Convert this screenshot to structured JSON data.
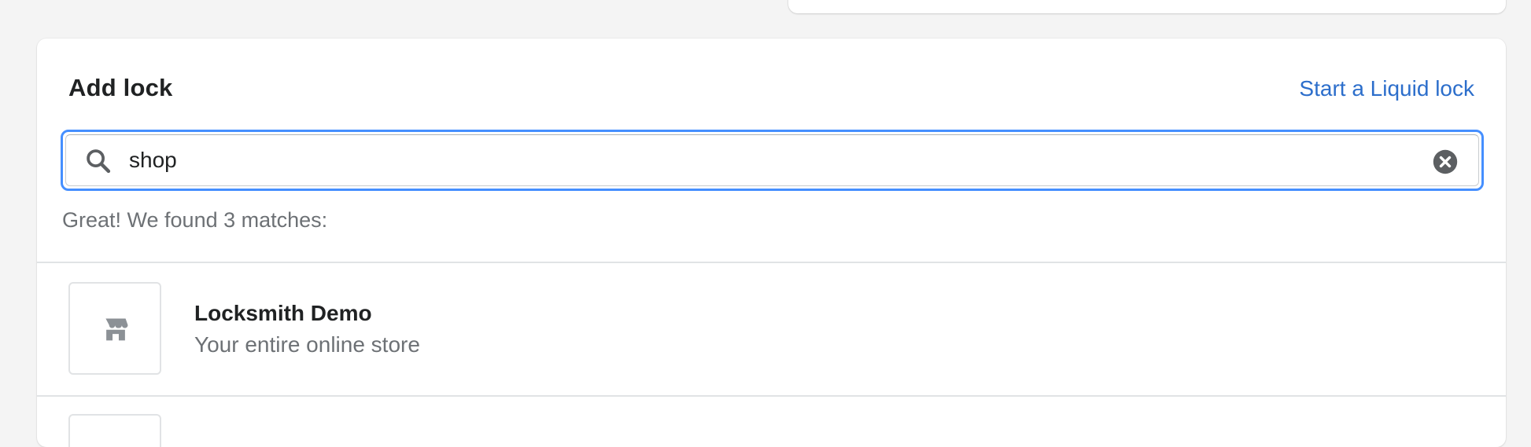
{
  "add_lock": {
    "title": "Add lock",
    "liquid_link": "Start a Liquid lock"
  },
  "search": {
    "value": "shop",
    "icon": "search-icon",
    "clear_icon": "clear-icon"
  },
  "results": {
    "summary": "Great! We found 3 matches:",
    "items": [
      {
        "title": "Locksmith Demo",
        "subtitle": "Your entire online store",
        "icon": "store-icon"
      }
    ]
  },
  "colors": {
    "link": "#2c6ecb",
    "focus_ring": "#458fff",
    "subdued_text": "#6d7175",
    "icon_gray": "#8c9196"
  }
}
